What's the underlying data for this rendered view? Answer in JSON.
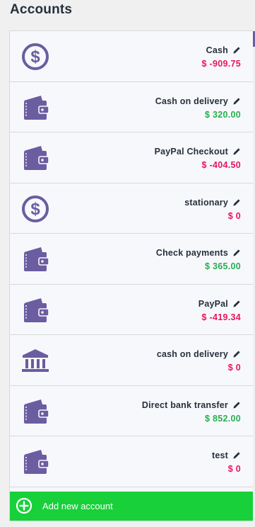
{
  "page": {
    "title": "Accounts"
  },
  "colors": {
    "icon": "#6b5da0",
    "negative": "#e8155a",
    "positive": "#27ae4f",
    "add_button": "#18d03a"
  },
  "accounts": [
    {
      "name": "Cash",
      "amount": "$ -909.75",
      "sign": "negative",
      "icon": "dollar-icon"
    },
    {
      "name": "Cash on delivery",
      "amount": "$ 320.00",
      "sign": "positive",
      "icon": "wallet-icon"
    },
    {
      "name": "PayPal Checkout",
      "amount": "$ -404.50",
      "sign": "negative",
      "icon": "wallet-icon"
    },
    {
      "name": "stationary",
      "amount": "$ 0",
      "sign": "negative",
      "icon": "dollar-icon"
    },
    {
      "name": "Check payments",
      "amount": "$ 365.00",
      "sign": "positive",
      "icon": "wallet-icon"
    },
    {
      "name": "PayPal",
      "amount": "$ -419.34",
      "sign": "negative",
      "icon": "wallet-icon"
    },
    {
      "name": "cash on delivery",
      "amount": "$ 0",
      "sign": "negative",
      "icon": "bank-icon"
    },
    {
      "name": "Direct bank transfer",
      "amount": "$ 852.00",
      "sign": "positive",
      "icon": "wallet-icon"
    },
    {
      "name": "test",
      "amount": "$ 0",
      "sign": "negative",
      "icon": "wallet-icon"
    }
  ],
  "add_button": {
    "label": "Add new account",
    "icon": "plus-circle-icon"
  }
}
